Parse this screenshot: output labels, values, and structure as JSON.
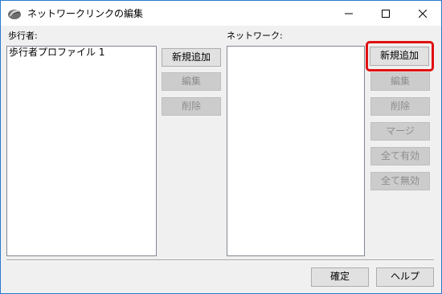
{
  "window": {
    "title": "ネットワークリンクの編集",
    "accent_color": "#2b79d0",
    "controls": {
      "minimize_icon": "minimize-icon",
      "maximize_icon": "maximize-icon",
      "close_icon": "close-icon"
    }
  },
  "pedestrian": {
    "label": "歩行者:",
    "items": [
      "歩行者プロファイル 1"
    ],
    "buttons": {
      "add": "新規追加",
      "edit": "編集",
      "delete": "削除"
    }
  },
  "network": {
    "label": "ネットワーク:",
    "items": [],
    "buttons": {
      "add": "新規追加",
      "edit": "編集",
      "delete": "削除",
      "merge": "マージ",
      "enable_all": "全て有効",
      "disable_all": "全て無効"
    },
    "highlight_color": "#e01010"
  },
  "footer": {
    "ok": "確定",
    "help": "ヘルプ"
  }
}
